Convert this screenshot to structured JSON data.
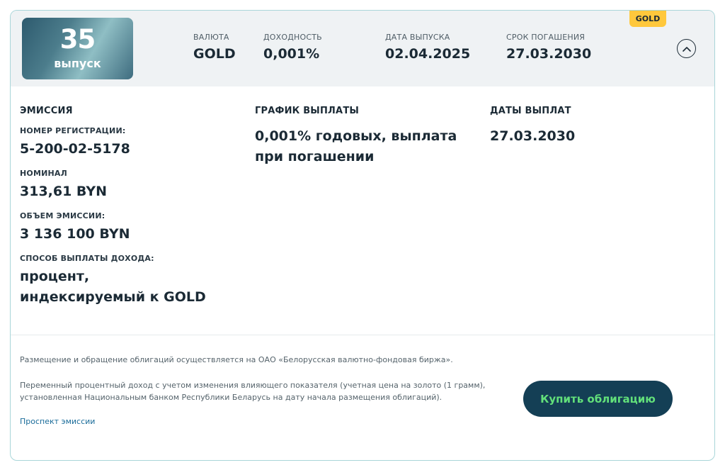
{
  "header": {
    "issue_number": "35",
    "issue_label": "выпуск",
    "meta": [
      {
        "label": "ВАЛЮТА",
        "value": "GOLD"
      },
      {
        "label": "ДОХОДНОСТЬ",
        "value": "0,001%"
      },
      {
        "label": "ДАТА ВЫПУСКА",
        "value": "02.04.2025"
      },
      {
        "label": "СРОК ПОГАШЕНИЯ",
        "value": "27.03.2030"
      }
    ],
    "badge": "GOLD",
    "collapse_icon": "chevron-up-icon"
  },
  "emission": {
    "title": "ЭМИССИЯ",
    "reg_label": "НОМЕР РЕГИСТРАЦИИ:",
    "reg_value": "5-200-02-5178",
    "nominal_label": "НОМИНАЛ",
    "nominal_value": "313,61 BYN",
    "volume_label": "ОБЪЕМ ЭМИССИИ:",
    "volume_value": "3 136 100 BYN",
    "method_label": "СПОСОБ ВЫПЛАТЫ ДОХОДА:",
    "method_value": "процент, индексируемый к GOLD"
  },
  "schedule": {
    "title": "ГРАФИК ВЫПЛАТЫ",
    "value": "0,001% годовых, выплата при погашении"
  },
  "payment_dates": {
    "title": "ДАТЫ ВЫПЛАТ",
    "value": "27.03.2030"
  },
  "footer": {
    "note1": "Размещение и обращение облигаций осуществляется на ОАО «Белорусская валютно-фондовая биржа».",
    "note2_line1": "Переменный процентный доход с учетом изменения влияющего показателя (учетная цена на золото (1 грамм),",
    "note2_line2": "установленная Национальным банком Республики Беларусь на дату начала размещения облигаций).",
    "prospectus_link": "Проспект эмиссии",
    "buy_button": "Купить облигацию"
  },
  "colors": {
    "accent": "#143f55",
    "button_text": "#62e07a",
    "badge": "#ffc83c",
    "border": "#a9d6d9"
  }
}
